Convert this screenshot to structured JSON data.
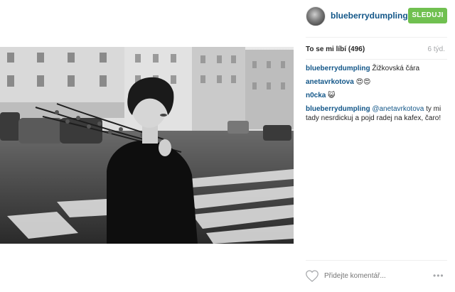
{
  "post": {
    "username": "blueberrydumpling",
    "follow_label": "SLEDUJI",
    "likes": "To se mi líbí (496)",
    "age": "6 týd.",
    "comments": [
      {
        "user": "blueberrydumpling",
        "mention": "",
        "text": "Žižkovská čára"
      },
      {
        "user": "anetavrkotova",
        "mention": "",
        "text": "😍😍"
      },
      {
        "user": "n0cka",
        "mention": "",
        "text": "😺"
      },
      {
        "user": "blueberrydumpling",
        "mention": "@anetavrkotova",
        "text": "ty mi tady nesrdickuj a pojd radej na kafex, čaro!"
      }
    ],
    "add_comment_placeholder": "Přidejte komentář...",
    "more_label": "•••"
  },
  "colors": {
    "accent": "#125688",
    "follow": "#70c050",
    "muted": "#a5a7aa"
  },
  "icons": [
    "heart-icon",
    "more-options-icon"
  ]
}
